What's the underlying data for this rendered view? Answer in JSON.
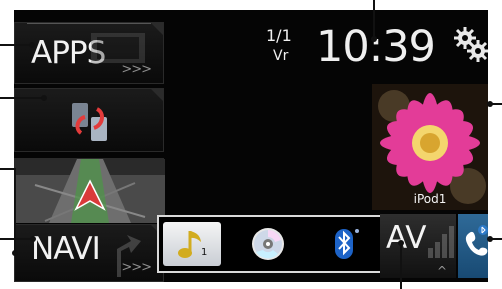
{
  "tiles": {
    "apps_label": "APPS",
    "apps_chevron": ">>>",
    "navi_label": "NAVI",
    "navi_chevron": ">>>"
  },
  "status": {
    "date": "1/1",
    "weekday": "Vr",
    "time": "10:39"
  },
  "album": {
    "caption": "iPod1"
  },
  "sources": {
    "music_index": "1",
    "items": [
      "music-note-icon",
      "disc-icon",
      "bluetooth-icon"
    ]
  },
  "av": {
    "label": "AV",
    "chevron": "^"
  },
  "colors": {
    "background": "#050505",
    "source_bar_border": "#d9d9d9",
    "accent_red": "#e33b3b",
    "phone_blue": "#2f6a98"
  }
}
